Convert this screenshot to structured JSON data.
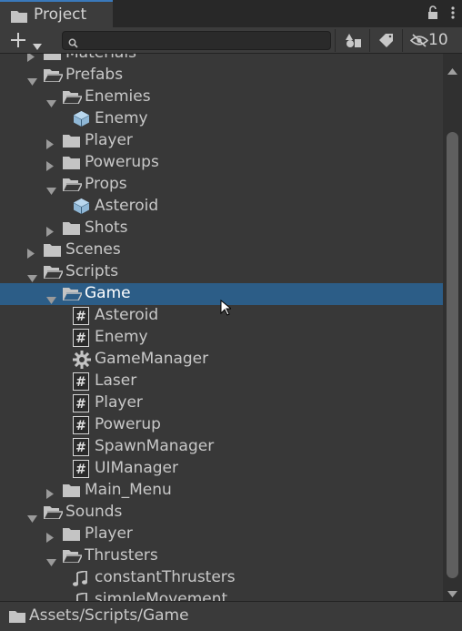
{
  "window": {
    "tab_title": "Project",
    "tab_icon": "folder-icon",
    "lock_icon": "lock-icon",
    "menu_icon": "kebab-menu-icon"
  },
  "toolbar": {
    "create_icon": "plus-icon",
    "search_placeholder": "",
    "filter_type_icon": "shapes-icon",
    "filter_label_icon": "tag-icon",
    "hidden_icon": "eye-slash-icon",
    "hidden_packages_count": "10"
  },
  "tree": {
    "rows": [
      {
        "label": "Materials",
        "depth": 1,
        "expanded": false,
        "kind": "folder"
      },
      {
        "label": "Prefabs",
        "depth": 1,
        "expanded": true,
        "kind": "folder"
      },
      {
        "label": "Enemies",
        "depth": 2,
        "expanded": true,
        "kind": "folder"
      },
      {
        "label": "Enemy",
        "depth": 3,
        "kind": "prefab"
      },
      {
        "label": "Player",
        "depth": 2,
        "expanded": false,
        "kind": "folder"
      },
      {
        "label": "Powerups",
        "depth": 2,
        "expanded": false,
        "kind": "folder"
      },
      {
        "label": "Props",
        "depth": 2,
        "expanded": true,
        "kind": "folder"
      },
      {
        "label": "Asteroid",
        "depth": 3,
        "kind": "prefab"
      },
      {
        "label": "Shots",
        "depth": 2,
        "expanded": false,
        "kind": "folder"
      },
      {
        "label": "Scenes",
        "depth": 1,
        "expanded": false,
        "kind": "folder"
      },
      {
        "label": "Scripts",
        "depth": 1,
        "expanded": true,
        "kind": "folder"
      },
      {
        "label": "Game",
        "depth": 2,
        "expanded": true,
        "kind": "folder",
        "selected": true
      },
      {
        "label": "Asteroid",
        "depth": 3,
        "kind": "script"
      },
      {
        "label": "Enemy",
        "depth": 3,
        "kind": "script"
      },
      {
        "label": "GameManager",
        "depth": 3,
        "kind": "gear"
      },
      {
        "label": "Laser",
        "depth": 3,
        "kind": "script"
      },
      {
        "label": "Player",
        "depth": 3,
        "kind": "script"
      },
      {
        "label": "Powerup",
        "depth": 3,
        "kind": "script"
      },
      {
        "label": "SpawnManager",
        "depth": 3,
        "kind": "script"
      },
      {
        "label": "UIManager",
        "depth": 3,
        "kind": "script"
      },
      {
        "label": "Main_Menu",
        "depth": 2,
        "expanded": false,
        "kind": "folder"
      },
      {
        "label": "Sounds",
        "depth": 1,
        "expanded": true,
        "kind": "folder"
      },
      {
        "label": "Player",
        "depth": 2,
        "expanded": false,
        "kind": "folder"
      },
      {
        "label": "Thrusters",
        "depth": 2,
        "expanded": true,
        "kind": "folder"
      },
      {
        "label": "constantThrusters",
        "depth": 3,
        "kind": "audio"
      },
      {
        "label": "simpleMovement",
        "depth": 3,
        "kind": "audio"
      }
    ]
  },
  "status_bar": {
    "path": "Assets/Scripts/Game",
    "icon": "folder-icon"
  },
  "colors": {
    "background": "#383838",
    "selection": "#2c5d87",
    "tab_accent": "#3a79bb"
  }
}
